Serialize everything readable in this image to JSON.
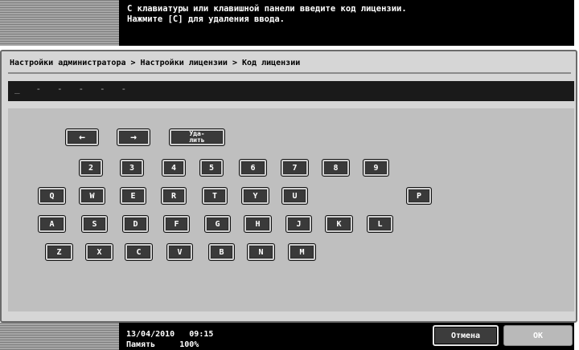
{
  "header": {
    "message_line1": "С клавиатуры или клавишной панели введите код лицензии.",
    "message_line2": "Нажмите [C] для удаления ввода."
  },
  "breadcrumb": "Настройки администратора > Настройки лицензии > Код лицензии",
  "entry_field": {
    "value": "_   -   -   -   -   -"
  },
  "keyboard": {
    "left_arrow": "←",
    "right_arrow": "→",
    "delete": "Уда-\nлить",
    "digits": [
      "2",
      "3",
      "4",
      "5",
      "6",
      "7",
      "8",
      "9"
    ],
    "row_q": [
      "Q",
      "W",
      "E",
      "R",
      "T",
      "Y",
      "U",
      "P"
    ],
    "row_a": [
      "A",
      "S",
      "D",
      "F",
      "G",
      "H",
      "J",
      "K",
      "L"
    ],
    "row_z": [
      "Z",
      "X",
      "C",
      "V",
      "B",
      "N",
      "M"
    ]
  },
  "footer": {
    "date": "13/04/2010",
    "time": "09:15",
    "memory_label": "Память",
    "memory_value": "100%",
    "cancel_label": "Отмена",
    "ok_label": "OK"
  }
}
